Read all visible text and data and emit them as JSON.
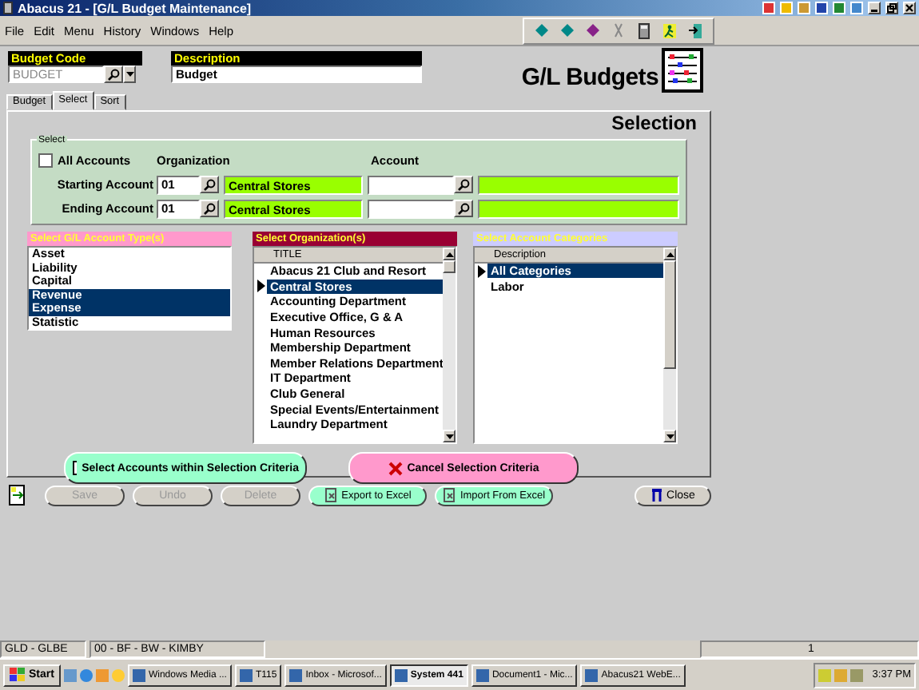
{
  "window": {
    "title": "Abacus 21 - [G/L Budget Maintenance]"
  },
  "menu": [
    "File",
    "Edit",
    "Menu",
    "History",
    "Windows",
    "Help"
  ],
  "header": {
    "budget_code": {
      "label": "Budget Code",
      "value": "BUDGET"
    },
    "description": {
      "label": "Description",
      "value": "Budget"
    },
    "logo_title": "G/L Budgets"
  },
  "tabs": [
    {
      "label": "Budget",
      "selected": false
    },
    {
      "label": "Select",
      "selected": true
    },
    {
      "label": "Sort",
      "selected": false
    }
  ],
  "panel_title": "Selection",
  "select_group": {
    "legend": "Select",
    "all_accounts": {
      "label": "All Accounts",
      "checked": false
    },
    "organization_label": "Organization",
    "account_label": "Account",
    "rows": [
      {
        "label": "Starting Account",
        "org_code": "01",
        "org_name": "Central Stores"
      },
      {
        "label": "Ending Account",
        "org_code": "01",
        "org_name": "Central Stores"
      }
    ]
  },
  "account_types": {
    "title": "Select G/L Account Type(s)",
    "items": [
      {
        "label": "Asset",
        "selected": false
      },
      {
        "label": "Liability",
        "selected": false
      },
      {
        "label": "Capital",
        "selected": false
      },
      {
        "label": "Revenue",
        "selected": true
      },
      {
        "label": "Expense",
        "selected": true
      },
      {
        "label": "Statistic",
        "selected": false
      }
    ]
  },
  "organizations": {
    "title": "Select Organization(s)",
    "column": "TITLE",
    "items": [
      {
        "label": "Abacus 21 Club and Resort",
        "selected": false
      },
      {
        "label": "Central Stores",
        "selected": true
      },
      {
        "label": "Accounting Department",
        "selected": false
      },
      {
        "label": "Executive Office, G & A",
        "selected": false
      },
      {
        "label": "Human Resources",
        "selected": false
      },
      {
        "label": "Membership Department",
        "selected": false
      },
      {
        "label": "Member Relations Department",
        "selected": false
      },
      {
        "label": "IT Department",
        "selected": false
      },
      {
        "label": "Club General",
        "selected": false
      },
      {
        "label": "Special Events/Entertainment",
        "selected": false
      },
      {
        "label": "Laundry Department",
        "selected": false
      }
    ]
  },
  "categories": {
    "title": "Select Account Categories",
    "column": "Description",
    "items": [
      {
        "label": "All Categories",
        "selected": true
      },
      {
        "label": "Labor",
        "selected": false
      }
    ]
  },
  "actions": [
    {
      "label": "Select Accounts within Selection Criteria",
      "kind": "select"
    },
    {
      "label": "Cancel Selection Criteria",
      "kind": "cancel"
    }
  ],
  "toolbar_buttons": [
    {
      "label": "Save",
      "kind": "plain",
      "disabled": true
    },
    {
      "label": "Undo",
      "kind": "plain",
      "disabled": true
    },
    {
      "label": "Delete",
      "kind": "plain",
      "disabled": true
    },
    {
      "label": "Export to Excel",
      "kind": "excel",
      "disabled": false
    },
    {
      "label": "Import From Excel",
      "kind": "excel",
      "disabled": false
    },
    {
      "label": "Close",
      "kind": "close",
      "disabled": false
    }
  ],
  "status_bar": [
    "GLD - GLBE",
    "00 - BF - BW - KIMBY",
    "1"
  ],
  "taskbar": {
    "start": "Start",
    "tasks": [
      {
        "label": "Windows Media ...",
        "selected": false
      },
      {
        "label": "T115",
        "selected": false
      },
      {
        "label": "Inbox - Microsof...",
        "selected": false
      },
      {
        "label": "System 441",
        "selected": true
      },
      {
        "label": "Document1 - Mic...",
        "selected": false
      },
      {
        "label": "Abacus21 WebE...",
        "selected": false
      }
    ],
    "clock": "3:37 PM"
  }
}
